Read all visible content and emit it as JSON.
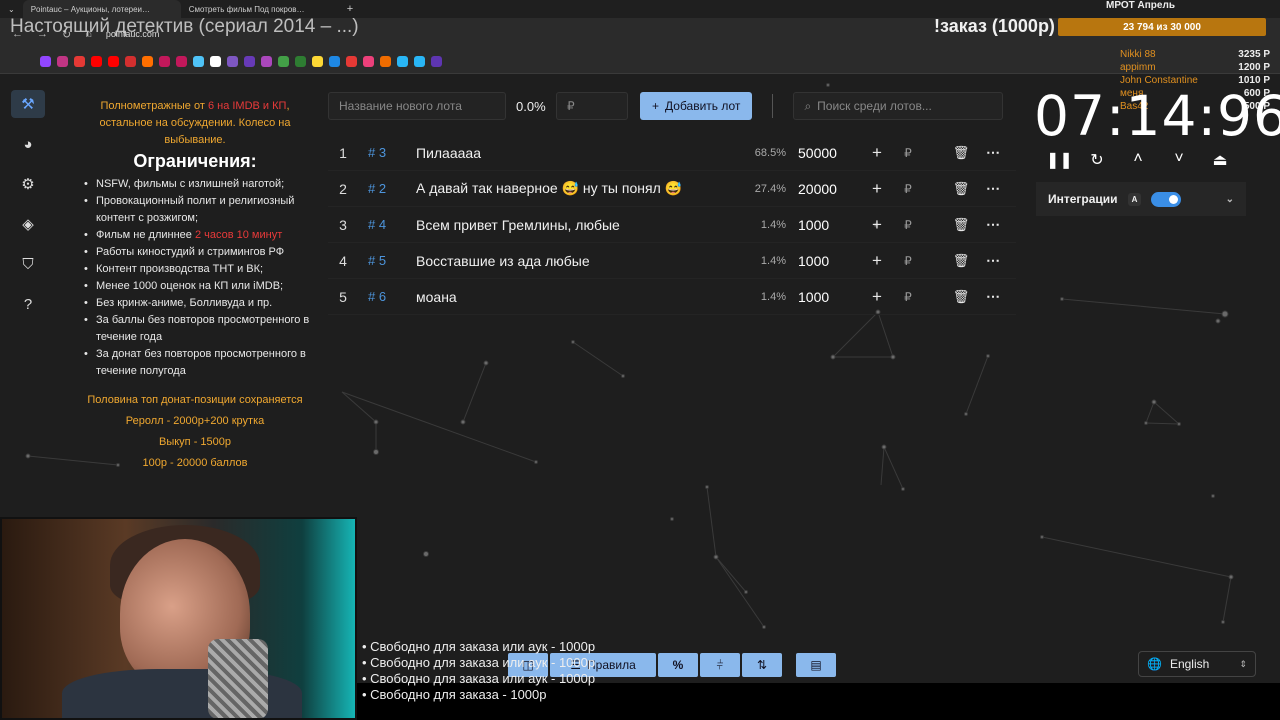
{
  "browser": {
    "tabs": [
      {
        "label": "Pointauc – Аукционы, лотереи…"
      },
      {
        "label": "Смотреть фильм Под покров…"
      }
    ],
    "new_tab": "+",
    "url": "pointauc.com"
  },
  "stream_title": "Настоящий детектив (сериал 2014 – ...)",
  "overlay": {
    "order_text": "!заказ (1000р)",
    "mrot_title": "МРОТ Апрель",
    "mrot_progress": "23 794 из 30 000",
    "mrot_value": 23794,
    "mrot_goal": 30000,
    "donors": [
      {
        "name": "Nikki 88",
        "amount": "3235 Р"
      },
      {
        "name": "appimm",
        "amount": "1200 Р"
      },
      {
        "name": "John Constantine",
        "amount": "1010 Р"
      },
      {
        "name": "меня",
        "amount": "600 Р"
      },
      {
        "name": "Bas42",
        "amount": "500 Р"
      }
    ]
  },
  "rules": {
    "intro_part1": "Полнометражные от ",
    "intro_red": "6 на IMDB и КП",
    "intro_part2": ", остальное на обсуждении. Колесо на выбывание.",
    "heading": "Ограничения:",
    "items": [
      "NSFW, фильмы с излишней наготой;",
      "Провокационный полит и религиозный контент с розжигом;",
      "Фильм не длиннее ",
      "Работы киностудий и стримингов РФ",
      "Контент производства ТНТ и ВК;",
      "Менее 1000 оценок на КП или iMDB;",
      "Без кринж-аниме, Болливуда и пр.",
      "За баллы без повторов просмотренного в течение года",
      "За донат без повторов просмотренного в течение полугода"
    ],
    "length_red": "2 часов 10 минут",
    "footer": [
      "Половина топ донат-позиции сохраняется",
      "Реролл - 2000р+200 крутка",
      "Выкуп - 1500р",
      "100р - 20000 баллов"
    ]
  },
  "lot_form": {
    "name_placeholder": "Название нового лота",
    "percent": "0.0%",
    "amount_placeholder": "₽",
    "add_button": "Добавить лот",
    "search_placeholder": "Поиск среди лотов..."
  },
  "lots": [
    {
      "index": "1",
      "fast_id": "# 3",
      "name": "Пилааааа",
      "percent": "68.5%",
      "amount": "50000"
    },
    {
      "index": "2",
      "fast_id": "# 2",
      "name": "А давай так наверное 😅 ну ты понял 😅",
      "percent": "27.4%",
      "amount": "20000"
    },
    {
      "index": "3",
      "fast_id": "# 4",
      "name": "Всем привет Гремлины, любые",
      "percent": "1.4%",
      "amount": "1000"
    },
    {
      "index": "4",
      "fast_id": "# 5",
      "name": "Восставшие из ада  любые",
      "percent": "1.4%",
      "amount": "1000"
    },
    {
      "index": "5",
      "fast_id": "# 6",
      "name": "моана",
      "percent": "1.4%",
      "amount": "1000"
    }
  ],
  "timer": {
    "display": "07:14:96"
  },
  "integrations": {
    "label": "Интеграции",
    "badge": "A",
    "enabled": true
  },
  "bottom": {
    "free_slots": [
      "• Свободно для заказа или аук - 1000р",
      "• Свободно для заказа или аук - 1000р",
      "• Свободно для заказа или аук - 1000р",
      "• Свободно для заказа - 1000р"
    ],
    "rules_button": "Правила",
    "percent_button": "%",
    "language": "English"
  },
  "icons": {
    "sidebar": [
      "gavel-icon",
      "wheel-icon",
      "gear-icon",
      "layers-icon",
      "shield-icon",
      "help-icon"
    ]
  }
}
